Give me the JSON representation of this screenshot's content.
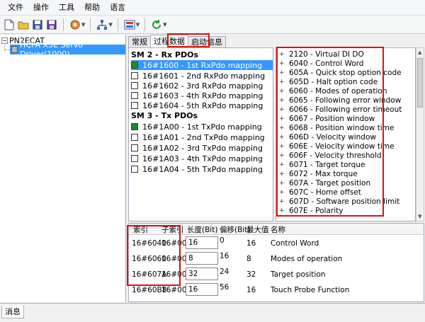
{
  "menu": [
    "文件",
    "操作",
    "工具",
    "帮助",
    "语言"
  ],
  "tree": {
    "root": "PN2ECAT",
    "child": "HCFA X3E Servo Driver(1000)"
  },
  "tabs": [
    {
      "label": "常规",
      "active": false
    },
    {
      "label": "过程数据",
      "active": true
    },
    {
      "label": "启动信息",
      "active": false
    }
  ],
  "sm2": {
    "title": "SM 2 - Rx PDOs",
    "rows": [
      {
        "label": "16#1600  -  1st RxPdo mapping",
        "checked": true,
        "selected": true
      },
      {
        "label": "16#1601  -  2nd RxPdo mapping",
        "checked": false,
        "selected": false
      },
      {
        "label": "16#1602  -  3rd RxPdo mapping",
        "checked": false,
        "selected": false
      },
      {
        "label": "16#1603  -  4th RxPdo mapping",
        "checked": false,
        "selected": false
      },
      {
        "label": "16#1604  -  5th RxPdo mapping",
        "checked": false,
        "selected": false
      }
    ]
  },
  "sm3": {
    "title": "SM 3 - Tx PDOs",
    "rows": [
      {
        "label": "16#1A00  -  1st TxPdo mapping",
        "checked": true
      },
      {
        "label": "16#1A01  -  2nd TxPdo mapping",
        "checked": false
      },
      {
        "label": "16#1A02  -  3rd TxPdo mapping",
        "checked": false
      },
      {
        "label": "16#1A03  -  4th TxPdo mapping",
        "checked": false
      },
      {
        "label": "16#1A04  -  5th TxPdo mapping",
        "checked": false
      }
    ]
  },
  "objects": [
    "2120 - Virtual DI DO",
    "6040 - Control Word",
    "605A - Quick stop option code",
    "605D - Halt option code",
    "6060 - Modes of operation",
    "6065 - Following error window",
    "6066 - Following error timeout",
    "6067 - Position window",
    "6068 - Position window time",
    "606D - Velocity window",
    "606E - Velocity window time",
    "606F - Velocity threshold",
    "6071 - Target torque",
    "6072 - Max torque",
    "607A - Target position",
    "607C - Home offset",
    "607D - Software position limit",
    "607E - Polarity"
  ],
  "grid": {
    "headers": [
      "索引",
      "子索引",
      "长度(Bit)",
      "偏移(Bit)",
      "最大值",
      "名称"
    ],
    "rows": [
      {
        "index": "16#6040",
        "sub": "16#00",
        "len": "16",
        "offset": "0",
        "max": "16",
        "name": "Control Word"
      },
      {
        "index": "16#6060",
        "sub": "16#00",
        "len": "8",
        "offset": "16",
        "max": "8",
        "name": "Modes of operation"
      },
      {
        "index": "16#607A",
        "sub": "16#00",
        "len": "32",
        "offset": "24",
        "max": "32",
        "name": "Target position"
      },
      {
        "index": "16#60B8",
        "sub": "16#00",
        "len": "16",
        "offset": "56",
        "max": "16",
        "name": "Touch Probe Function"
      }
    ]
  },
  "status_tab": "消息",
  "colors": {
    "highlight": "#e01010",
    "selection": "#3399ff",
    "checked": "#1a8a2a"
  }
}
